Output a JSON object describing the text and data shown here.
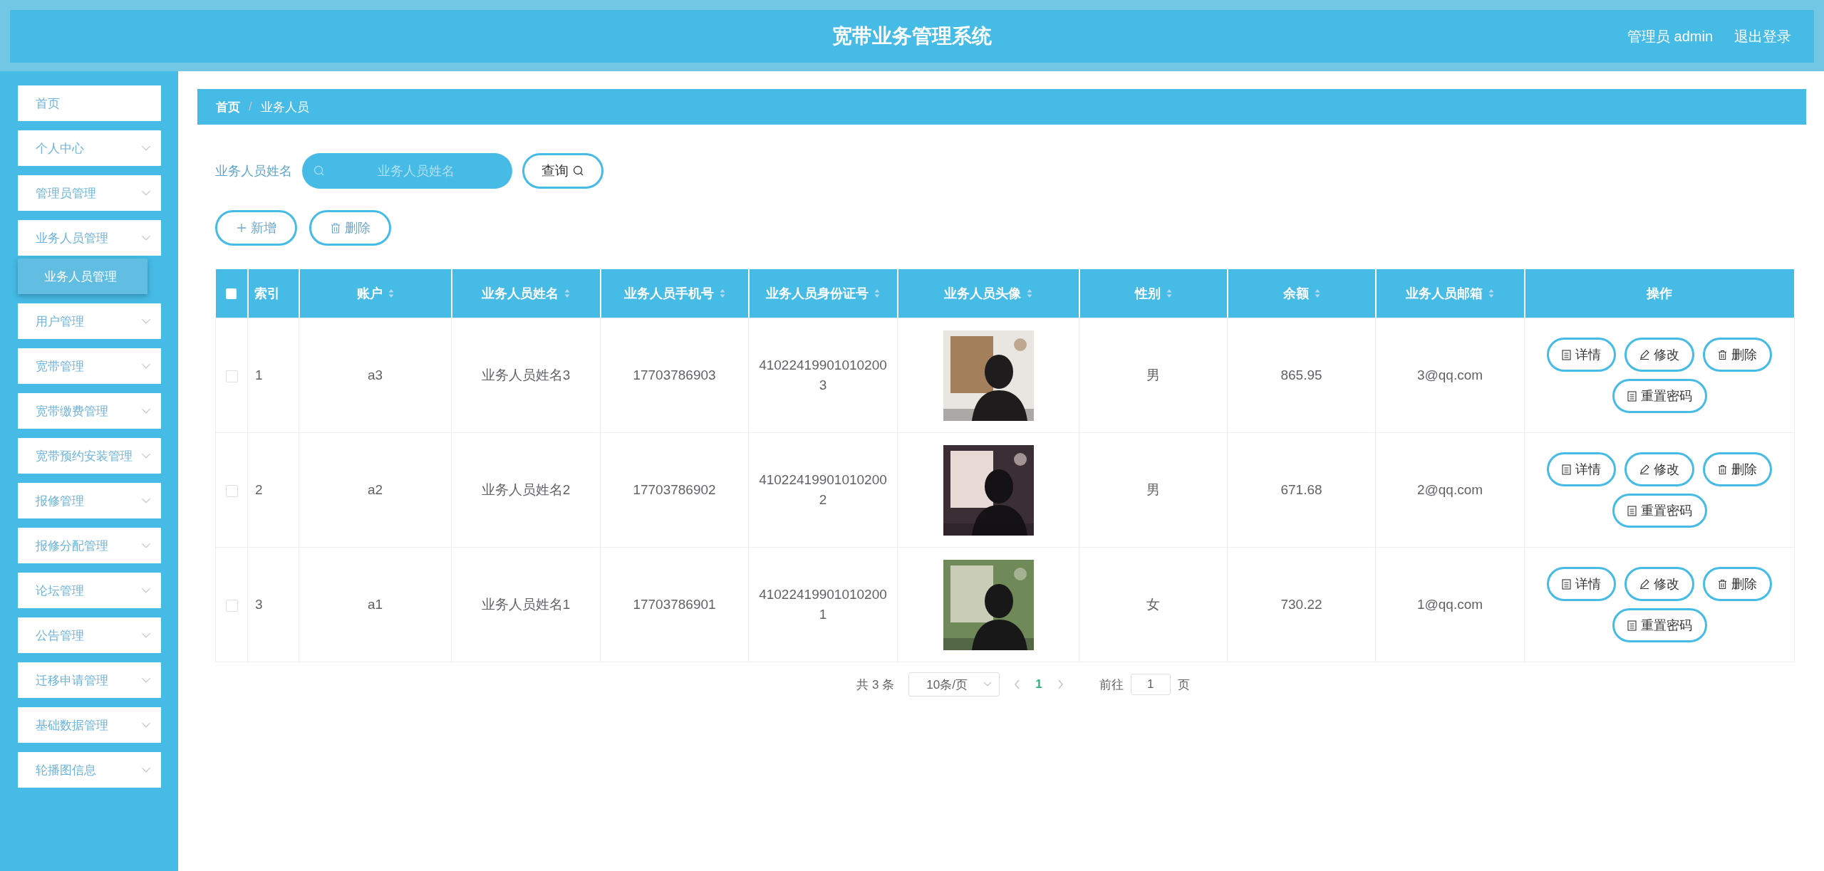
{
  "header": {
    "title": "宽带业务管理系统",
    "user": "管理员 admin",
    "logout": "退出登录"
  },
  "sidebar": {
    "items": [
      {
        "label": "首页",
        "kind": "link"
      },
      {
        "label": "个人中心",
        "kind": "menu"
      },
      {
        "label": "管理员管理",
        "kind": "menu"
      },
      {
        "label": "业务人员管理",
        "kind": "menu",
        "children": [
          {
            "label": "业务人员管理",
            "selected": true
          }
        ]
      },
      {
        "label": "用户管理",
        "kind": "menu"
      },
      {
        "label": "宽带管理",
        "kind": "menu"
      },
      {
        "label": "宽带缴费管理",
        "kind": "menu"
      },
      {
        "label": "宽带预约安装管理",
        "kind": "menu"
      },
      {
        "label": "报修管理",
        "kind": "menu"
      },
      {
        "label": "报修分配管理",
        "kind": "menu"
      },
      {
        "label": "论坛管理",
        "kind": "menu"
      },
      {
        "label": "公告管理",
        "kind": "menu"
      },
      {
        "label": "迁移申请管理",
        "kind": "menu"
      },
      {
        "label": "基础数据管理",
        "kind": "menu"
      },
      {
        "label": "轮播图信息",
        "kind": "menu"
      }
    ]
  },
  "breadcrumb": [
    "首页",
    "业务人员"
  ],
  "breadcrumb_separator": "/",
  "search": {
    "label": "业务人员姓名",
    "placeholder": "业务人员姓名",
    "button": "查询"
  },
  "toolbar": [
    {
      "label": "新增",
      "kind": "add"
    },
    {
      "label": "删除",
      "kind": "delete"
    }
  ],
  "table": {
    "header_checked": false,
    "columns": [
      {
        "label": "索引",
        "sortable": false
      },
      {
        "label": "账户",
        "sortable": true
      },
      {
        "label": "业务人员姓名",
        "sortable": true
      },
      {
        "label": "业务人员手机号",
        "sortable": true
      },
      {
        "label": "业务人员身份证号",
        "sortable": true
      },
      {
        "label": "业务人员头像",
        "sortable": true
      },
      {
        "label": "性别",
        "sortable": true
      },
      {
        "label": "余额",
        "sortable": true
      },
      {
        "label": "业务人员邮箱",
        "sortable": true
      },
      {
        "label": "操作",
        "sortable": false
      }
    ],
    "rows": [
      {
        "checked": false,
        "index": "1",
        "account": "a3",
        "name": "业务人员姓名3",
        "phone": "17703786903",
        "id_number": "410224199010102003",
        "gender": "男",
        "balance": "865.95",
        "email": "3@qq.com",
        "actions": [
          {
            "label": "详情",
            "kind": "detail"
          },
          {
            "label": "修改",
            "kind": "edit"
          },
          {
            "label": "删除",
            "kind": "delete"
          },
          {
            "label": "重置密码",
            "kind": "detail"
          }
        ]
      },
      {
        "checked": false,
        "index": "2",
        "account": "a2",
        "name": "业务人员姓名2",
        "phone": "17703786902",
        "id_number": "410224199010102002",
        "gender": "男",
        "balance": "671.68",
        "email": "2@qq.com",
        "actions": [
          {
            "label": "详情",
            "kind": "detail"
          },
          {
            "label": "修改",
            "kind": "edit"
          },
          {
            "label": "删除",
            "kind": "delete"
          },
          {
            "label": "重置密码",
            "kind": "detail"
          }
        ]
      },
      {
        "checked": false,
        "index": "3",
        "account": "a1",
        "name": "业务人员姓名1",
        "phone": "17703786901",
        "id_number": "410224199010102001",
        "gender": "女",
        "balance": "730.22",
        "email": "1@qq.com",
        "actions": [
          {
            "label": "详情",
            "kind": "detail"
          },
          {
            "label": "修改",
            "kind": "edit"
          },
          {
            "label": "删除",
            "kind": "delete"
          },
          {
            "label": "重置密码",
            "kind": "detail"
          }
        ]
      }
    ]
  },
  "pagination": {
    "total": "共 3 条",
    "page_size": "10条/页",
    "pages": [
      {
        "label": "1",
        "selected": true
      }
    ],
    "goto_label": "前往",
    "goto_value": "1",
    "goto_suffix": "页"
  }
}
